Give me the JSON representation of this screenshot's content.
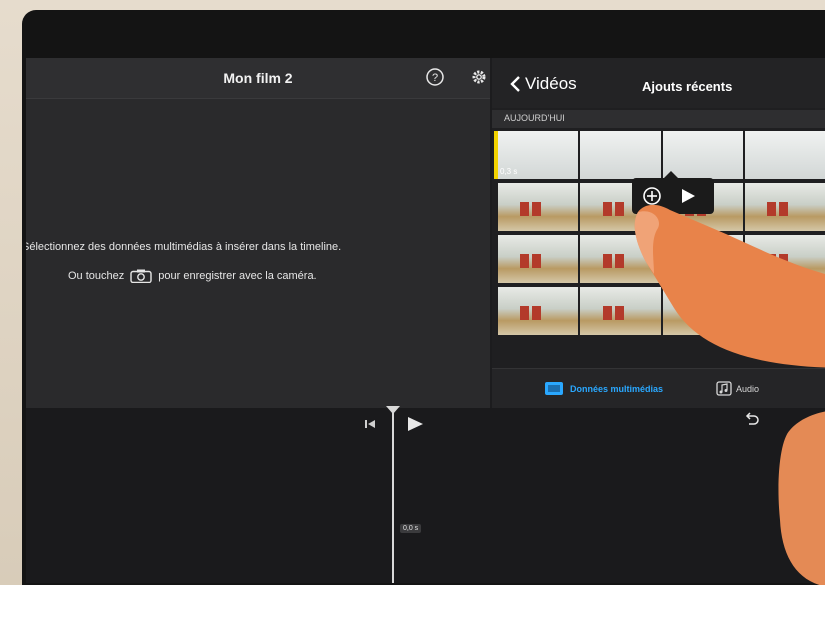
{
  "project": {
    "title": "Mon film 2",
    "help_icon": "help-icon",
    "settings_icon": "gear-icon"
  },
  "preview": {
    "instruction_line1": "Sélectionnez des données multimédias à insérer dans la timeline.",
    "instruction_prefix": "Ou touchez",
    "camera_icon": "camera-icon",
    "instruction_suffix": "pour enregistrer avec la caméra."
  },
  "browser": {
    "back_label": "Vidéos",
    "title": "Ajouts récents",
    "section": "AUJOURD'HUI",
    "clip_duration": "0,3 s",
    "accent_color": "#2aa8ff",
    "highlight_color": "#f2d200",
    "tabs": [
      {
        "label": "Données multimédias",
        "icon": "media-icon",
        "selected": true
      },
      {
        "label": "Audio",
        "icon": "audio-icon",
        "selected": false
      }
    ],
    "popup": {
      "add_icon": "add-circle-icon",
      "play_icon": "play-icon"
    }
  },
  "timeline": {
    "time": "0,0 s",
    "skip_icon": "skip-back-icon",
    "play_icon": "play-icon",
    "undo_icon": "undo-icon"
  }
}
